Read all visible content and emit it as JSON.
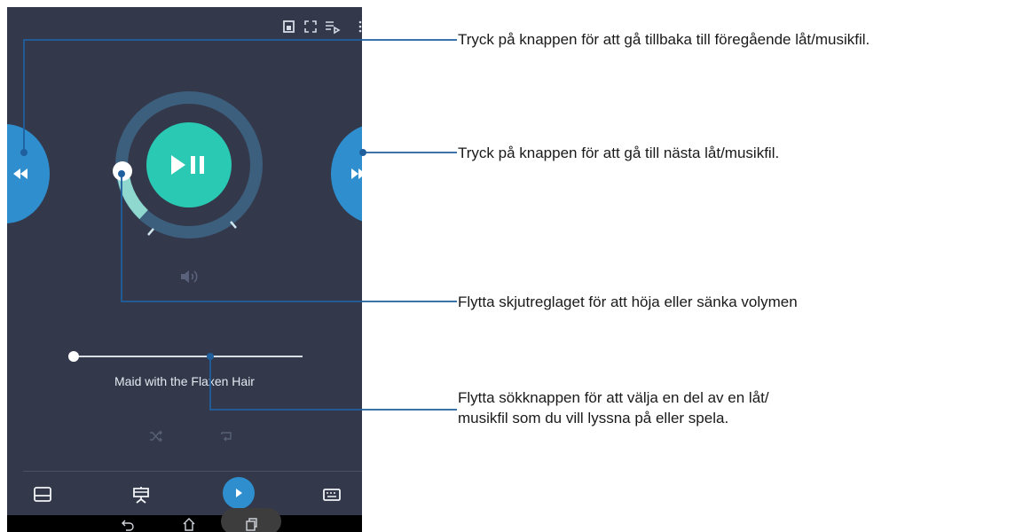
{
  "player": {
    "song_title": "Maid with the Flaxen Hair",
    "volume_fraction": 0.17
  },
  "icons": {
    "top": [
      "cast-icon",
      "fullscreen-icon",
      "playlist-icon",
      "more-vert-icon"
    ],
    "bottom": [
      "touchpad-icon",
      "presentation-icon",
      "play-icon",
      "keyboard-icon"
    ],
    "nav": [
      "back-icon",
      "home-icon",
      "recent-apps-icon"
    ]
  },
  "annotations": {
    "previous": "Tryck på knappen för att gå tillbaka till föregående låt/musikfil.",
    "next": "Tryck på knappen för att gå till nästa låt/musikfil.",
    "volume": "Flytta skjutreglaget för att höja eller sänka volymen",
    "seek_line1": "Flytta sökknappen för att välja en del av en låt/",
    "seek_line2": "musikfil som du vill lyssna på eller spela."
  },
  "colors": {
    "background": "#33394b",
    "accent_blue": "#2f8fce",
    "accent_teal": "#2ac9b3",
    "leader_line": "#1f5f9e"
  }
}
